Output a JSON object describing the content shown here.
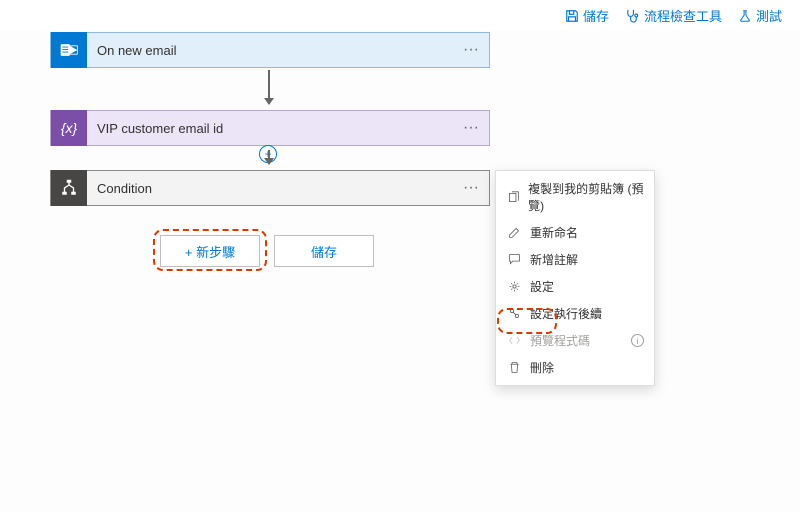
{
  "topbar": {
    "save": "儲存",
    "checker": "流程檢查工具",
    "test": "測試"
  },
  "cards": {
    "trigger": "On new email",
    "variable": "VIP customer email id",
    "condition": "Condition"
  },
  "buttons": {
    "newstep": "+ 新步驟",
    "save": "儲存"
  },
  "menu": {
    "copy": "複製到我的剪貼簿 (預覽)",
    "rename": "重新命名",
    "comment": "新增註解",
    "settings": "設定",
    "runafter": "設定執行後續",
    "peek": "預覽程式碼",
    "delete": "刪除"
  }
}
